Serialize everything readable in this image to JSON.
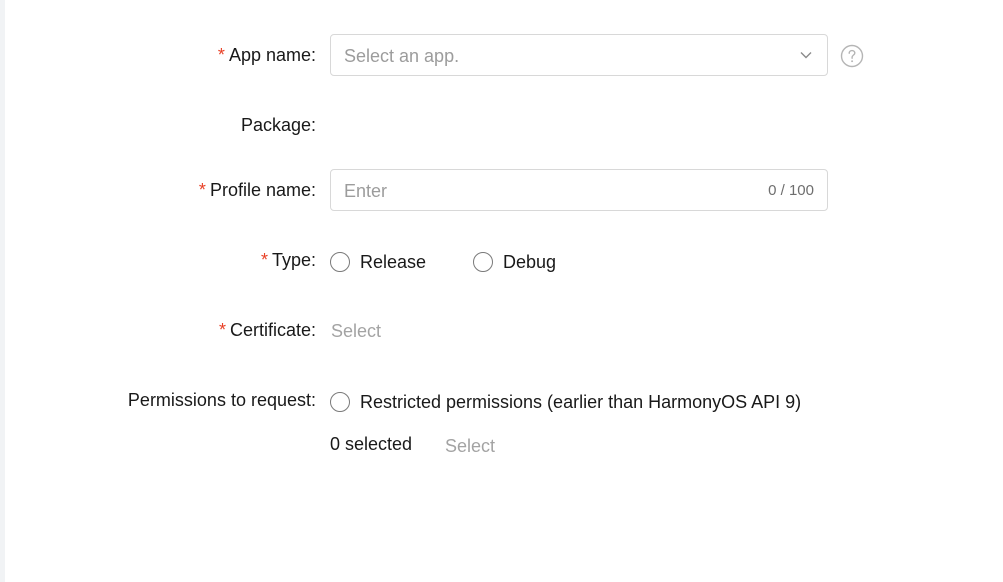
{
  "form": {
    "app_name": {
      "required_mark": "*",
      "label": "App name:",
      "placeholder": "Select an app."
    },
    "package": {
      "label": "Package:"
    },
    "profile_name": {
      "required_mark": "*",
      "label": "Profile name:",
      "placeholder": "Enter",
      "counter": "0 / 100"
    },
    "type": {
      "required_mark": "*",
      "label": "Type:",
      "options": [
        "Release",
        "Debug"
      ]
    },
    "certificate": {
      "required_mark": "*",
      "label": "Certificate:",
      "select_link": "Select"
    },
    "permissions": {
      "label": "Permissions to request:",
      "restricted_option": "Restricted permissions (earlier than HarmonyOS API 9)",
      "selected_count": "0 selected",
      "select_link": "Select"
    }
  },
  "icons": {
    "dropdown": "chevron-down-icon",
    "help": "help-circle-icon"
  }
}
